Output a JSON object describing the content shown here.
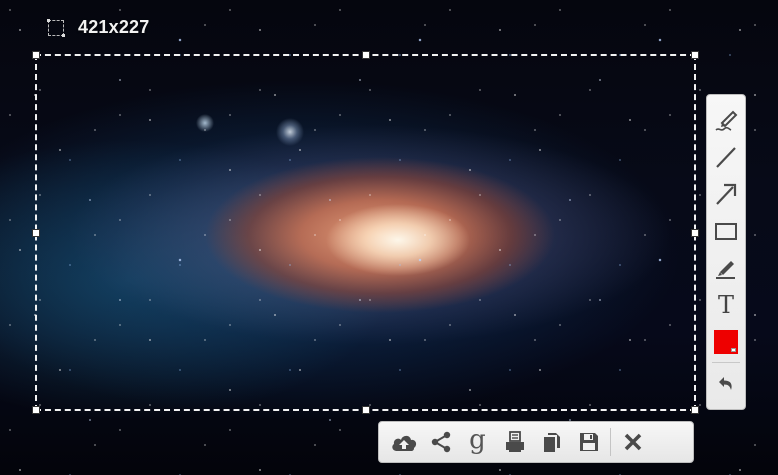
{
  "selection": {
    "size_label": "421x227"
  },
  "tool_palette": {
    "tools": [
      {
        "name": "freehand-pen",
        "icon": "pen-squiggle-icon"
      },
      {
        "name": "line",
        "icon": "line-icon"
      },
      {
        "name": "arrow",
        "icon": "arrow-icon"
      },
      {
        "name": "rectangle",
        "icon": "rectangle-icon"
      },
      {
        "name": "highlighter",
        "icon": "marker-icon"
      },
      {
        "name": "text",
        "icon": "text-icon",
        "glyph": "T"
      },
      {
        "name": "color",
        "icon": "color-swatch"
      },
      {
        "name": "undo",
        "icon": "undo-icon"
      }
    ],
    "active_color": "#ee0000"
  },
  "action_bar": {
    "actions": [
      {
        "name": "upload",
        "icon": "cloud-upload-icon"
      },
      {
        "name": "share",
        "icon": "share-icon"
      },
      {
        "name": "google-search",
        "icon": "google-g-icon",
        "glyph": "g"
      },
      {
        "name": "print",
        "icon": "print-icon"
      },
      {
        "name": "copy",
        "icon": "copy-icon"
      },
      {
        "name": "save",
        "icon": "save-icon"
      },
      {
        "name": "close",
        "icon": "close-icon"
      }
    ]
  },
  "colors": {
    "toolbar_bg": "#efefef",
    "toolbar_border": "#bdbdbd",
    "icon": "#4a4a4a",
    "selection_border": "#ffffff"
  }
}
